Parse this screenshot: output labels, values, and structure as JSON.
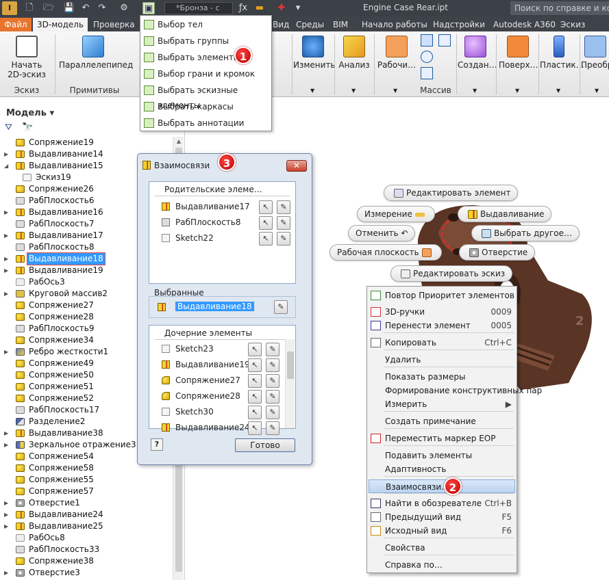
{
  "titlebar": {
    "app_logo": "I",
    "material": "*Бронза - с",
    "document": "Engine Case Rear.ipt",
    "search_placeholder": "Поиск по справке и ком"
  },
  "tabs": [
    {
      "label": "Файл"
    },
    {
      "label": "3D-модель"
    },
    {
      "label": "Проверка"
    },
    {
      "label": "Вид"
    },
    {
      "label": "Среды"
    },
    {
      "label": "BIM"
    },
    {
      "label": "Начало работы"
    },
    {
      "label": "Надстройки"
    },
    {
      "label": "Autodesk A360"
    },
    {
      "label": "Эскиз"
    }
  ],
  "ribbon": {
    "start_sketch": "Начать\n2D-эскиз",
    "sketch_panel": "Эскиз",
    "box": "Параллелепипед",
    "primitives_panel": "Примитивы",
    "modify": "Изменить",
    "analysis": "Анализ",
    "work": "Рабочи…",
    "pattern_panel": "Массив",
    "create": "Создан…",
    "surface": "Поверх…",
    "plastic": "Пластик…",
    "convert": "Преобр"
  },
  "select_menu": {
    "items": [
      "Выбор тел",
      "Выбрать группы",
      "Выбрать элементы",
      "Выбор грани и кромок",
      "Выбрать эскизные элементы",
      "Выбрать каркасы",
      "Выбрать аннотации"
    ]
  },
  "browser": {
    "header": "Модель ▾",
    "nodes": [
      {
        "label": "Сопряжение19",
        "icon": "fillet",
        "exp": ""
      },
      {
        "label": "Выдавливание14",
        "icon": "extrude",
        "exp": "▶"
      },
      {
        "label": "Выдавливание15",
        "icon": "extrude",
        "exp": "◢"
      },
      {
        "label": "Эскиз19",
        "icon": "sketch",
        "exp": "",
        "indent": true
      },
      {
        "label": "Сопряжение26",
        "icon": "fillet",
        "exp": ""
      },
      {
        "label": "РабПлоскость6",
        "icon": "plane",
        "exp": ""
      },
      {
        "label": "Выдавливание16",
        "icon": "extrude",
        "exp": "▶"
      },
      {
        "label": "РабПлоскость7",
        "icon": "plane",
        "exp": ""
      },
      {
        "label": "Выдавливание17",
        "icon": "extrude",
        "exp": "▶"
      },
      {
        "label": "РабПлоскость8",
        "icon": "plane",
        "exp": ""
      },
      {
        "label": "Выдавливание18",
        "icon": "extrude",
        "exp": "▶",
        "selected": true
      },
      {
        "label": "Выдавливание19",
        "icon": "extrude",
        "exp": "▶"
      },
      {
        "label": "РабОсь3",
        "icon": "axis",
        "exp": ""
      },
      {
        "label": "Круговой массив2",
        "icon": "pattern",
        "exp": "▶"
      },
      {
        "label": "Сопряжение27",
        "icon": "fillet",
        "exp": ""
      },
      {
        "label": "Сопряжение28",
        "icon": "fillet",
        "exp": ""
      },
      {
        "label": "РабПлоскость9",
        "icon": "plane",
        "exp": ""
      },
      {
        "label": "Сопряжение34",
        "icon": "fillet",
        "exp": ""
      },
      {
        "label": "Ребро жесткости1",
        "icon": "rib",
        "exp": "▶"
      },
      {
        "label": "Сопряжение49",
        "icon": "fillet",
        "exp": ""
      },
      {
        "label": "Сопряжение50",
        "icon": "fillet",
        "exp": ""
      },
      {
        "label": "Сопряжение51",
        "icon": "fillet",
        "exp": ""
      },
      {
        "label": "Сопряжение52",
        "icon": "fillet",
        "exp": ""
      },
      {
        "label": "РабПлоскость17",
        "icon": "plane",
        "exp": ""
      },
      {
        "label": "Разделение2",
        "icon": "split",
        "exp": ""
      },
      {
        "label": "Выдавливание38",
        "icon": "extrude",
        "exp": "▶"
      },
      {
        "label": "Зеркальное отражение3",
        "icon": "mirror",
        "exp": "▶"
      },
      {
        "label": "Сопряжение54",
        "icon": "fillet",
        "exp": ""
      },
      {
        "label": "Сопряжение58",
        "icon": "fillet",
        "exp": ""
      },
      {
        "label": "Сопряжение55",
        "icon": "fillet",
        "exp": ""
      },
      {
        "label": "Сопряжение57",
        "icon": "fillet",
        "exp": ""
      },
      {
        "label": "Отверстие1",
        "icon": "hole",
        "exp": "▶"
      },
      {
        "label": "Выдавливание24",
        "icon": "extrude",
        "exp": "▶"
      },
      {
        "label": "Выдавливание25",
        "icon": "extrude",
        "exp": "▶"
      },
      {
        "label": "РабОсь8",
        "icon": "axis",
        "exp": ""
      },
      {
        "label": "РабПлоскость33",
        "icon": "plane",
        "exp": ""
      },
      {
        "label": "Сопряжение38",
        "icon": "fillet",
        "exp": ""
      },
      {
        "label": "Отверстие3",
        "icon": "hole",
        "exp": "▶"
      }
    ]
  },
  "dialog": {
    "title": "Взаимосвязи",
    "parents_header": "Родительские элеме…",
    "parents": [
      {
        "label": "Выдавливание17",
        "icon": "extrude"
      },
      {
        "label": "РабПлоскость8",
        "icon": "plane"
      },
      {
        "label": "Sketch22",
        "icon": "sketch"
      }
    ],
    "selected_header": "Выбранные",
    "selected": "Выдавливание18",
    "children_header": "Дочерние элементы",
    "children": [
      {
        "label": "Sketch23",
        "icon": "sketch"
      },
      {
        "label": "Выдавливание19",
        "icon": "extrude"
      },
      {
        "label": "Сопряжение27",
        "icon": "fillet"
      },
      {
        "label": "Сопряжение28",
        "icon": "fillet"
      },
      {
        "label": "Sketch30",
        "icon": "sketch"
      },
      {
        "label": "Выдавливание24",
        "icon": "extrude"
      }
    ],
    "done": "Готово",
    "help": "?"
  },
  "minibar": {
    "edit_feature": "Редактировать элемент",
    "measure": "Измерение",
    "extrude": "Выдавливание",
    "undo": "Отменить",
    "select_other": "Выбрать другое…",
    "work_plane": "Рабочая плоскость",
    "hole": "Отверстие",
    "edit_sketch": "Редактировать эскиз"
  },
  "context_menu": {
    "items": [
      {
        "label": "Повтор Приоритет элементов",
        "shortcut": ""
      },
      {
        "label": "3D-ручки",
        "shortcut": "0009"
      },
      {
        "label": "Перенести элемент",
        "shortcut": "0005"
      },
      {
        "label": "Копировать",
        "shortcut": "Ctrl+C"
      },
      {
        "label": "Удалить",
        "shortcut": ""
      },
      {
        "label": "Показать размеры",
        "shortcut": ""
      },
      {
        "label": "Формирование конструктивных пар",
        "shortcut": ""
      },
      {
        "label": "Измерить",
        "shortcut": "▶"
      },
      {
        "label": "Создать примечание",
        "shortcut": ""
      },
      {
        "label": "Переместить маркер EOP",
        "shortcut": ""
      },
      {
        "label": "Подавить элементы",
        "shortcut": ""
      },
      {
        "label": "Адаптивность",
        "shortcut": ""
      },
      {
        "label": "Взаимосвязи…",
        "shortcut": ""
      },
      {
        "label": "Найти в обозревателе",
        "shortcut": "Ctrl+B"
      },
      {
        "label": "Предыдущий вид",
        "shortcut": "F5"
      },
      {
        "label": "Исходный вид",
        "shortcut": "F6"
      },
      {
        "label": "Свойства",
        "shortcut": ""
      },
      {
        "label": "Справка по…",
        "shortcut": ""
      }
    ]
  },
  "badges": [
    "1",
    "2",
    "3"
  ],
  "colors": {
    "accent_file_tab": "#e8742d",
    "selection": "#3399ff",
    "badge": "#cc0000",
    "model_bronze": "#5a3424"
  }
}
